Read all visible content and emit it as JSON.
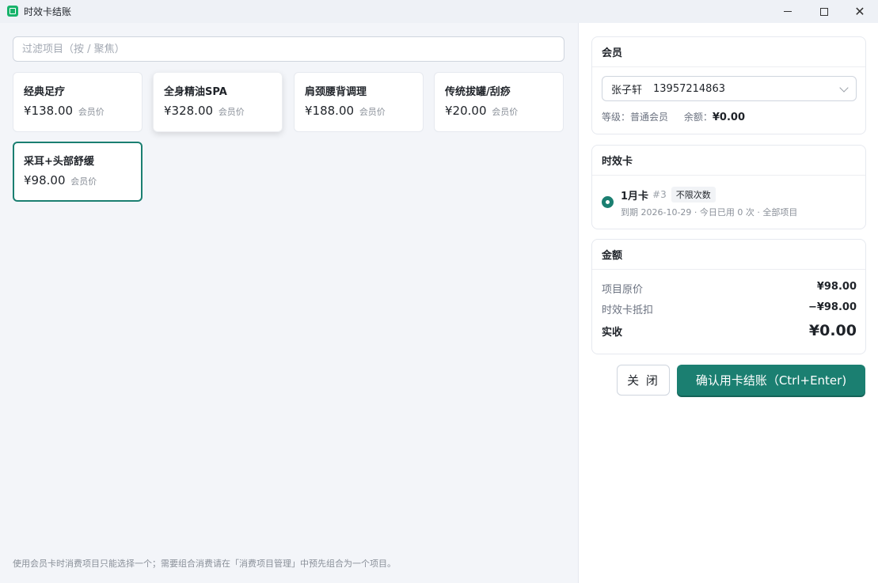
{
  "window": {
    "title": "时效卡结账",
    "icon": "app-logo-icon",
    "controls": [
      "minimize-icon",
      "maximize-icon",
      "close-icon"
    ]
  },
  "filter": {
    "placeholder": "过滤项目（按 / 聚焦）",
    "value": ""
  },
  "items": [
    {
      "name": "经典足疗",
      "price": "¥138.00",
      "tag": "会员价"
    },
    {
      "name": "全身精油SPA",
      "price": "¥328.00",
      "tag": "会员价"
    },
    {
      "name": "肩颈腰背调理",
      "price": "¥188.00",
      "tag": "会员价"
    },
    {
      "name": "传统拔罐/刮痧",
      "price": "¥20.00",
      "tag": "会员价"
    },
    {
      "name": "采耳+头部舒缓",
      "price": "¥98.00",
      "tag": "会员价"
    }
  ],
  "footnote": "使用会员卡时消费项目只能选择一个；需要组合消费请在「消费项目管理」中预先组合为一个项目。",
  "member": {
    "heading": "会员",
    "selected_name": "张子轩",
    "selected_phone": "13957214863",
    "level_label": "等级：",
    "level_value": "普通会员",
    "balance_label": "余额：",
    "balance_value": "¥0.00"
  },
  "timecard": {
    "heading": "时效卡",
    "name": "1月卡",
    "number": "#3",
    "badge": "不限次数",
    "detail": "到期 2026-10-29 · 今日已用 0 次 · 全部项目"
  },
  "amount": {
    "heading": "金额",
    "original_label": "项目原价",
    "original_value": "¥98.00",
    "deduct_label": "时效卡抵扣",
    "deduct_value": "−¥98.00",
    "total_label": "实收",
    "total_value": "¥0.00"
  },
  "actions": {
    "close_label": "关 闭",
    "confirm_label": "确认用卡结账（Ctrl+Enter)"
  },
  "colors": {
    "accent": "#1b7f71",
    "app_icon": "#18b36b"
  }
}
